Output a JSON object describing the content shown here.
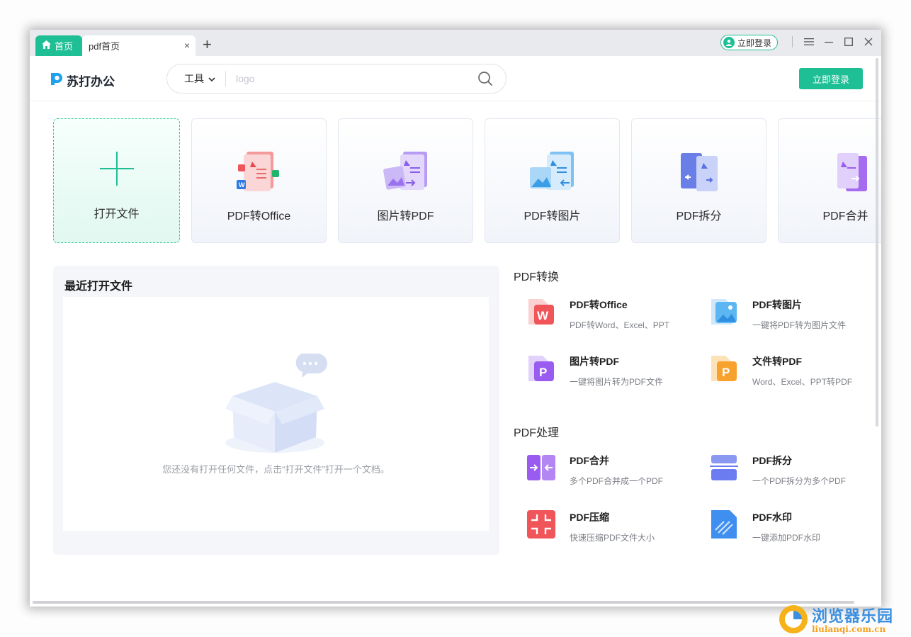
{
  "tabs": {
    "home_label": "首页",
    "active_label": "pdf首页",
    "close_glyph": "×",
    "new_tab_glyph": "+"
  },
  "titlebar": {
    "login_label": "立即登录"
  },
  "header": {
    "logo_text": "苏打办公",
    "tools_label": "工具",
    "search_placeholder": "logo",
    "login_button": "立即登录"
  },
  "cards": [
    {
      "label": "打开文件",
      "icon": "plus-icon"
    },
    {
      "label": "PDF转Office",
      "icon": "pdf-to-office-icon"
    },
    {
      "label": "图片转PDF",
      "icon": "image-to-pdf-icon"
    },
    {
      "label": "PDF转图片",
      "icon": "pdf-to-image-icon"
    },
    {
      "label": "PDF拆分",
      "icon": "pdf-split-icon"
    },
    {
      "label": "PDF合并",
      "icon": "pdf-merge-icon"
    }
  ],
  "recent": {
    "title": "最近打开文件",
    "empty_text": "您还没有打开任何文件，点击“打开文件”打开一个文档。"
  },
  "convert_section": {
    "title": "PDF转换",
    "items": [
      {
        "title": "PDF转Office",
        "desc": "PDF转Word、Excel、PPT",
        "icon": "word-icon",
        "color": "#f0555a"
      },
      {
        "title": "PDF转图片",
        "desc": "一键将PDF转为图片文件",
        "icon": "picture-icon",
        "color": "#3ea8f0"
      },
      {
        "title": "图片转PDF",
        "desc": "一键将图片转为PDF文件",
        "icon": "purple-p-icon",
        "color": "#9a5cf0"
      },
      {
        "title": "文件转PDF",
        "desc": "Word、Excel、PPT转PDF",
        "icon": "orange-p-icon",
        "color": "#f7a22e"
      }
    ]
  },
  "process_section": {
    "title": "PDF处理",
    "items": [
      {
        "title": "PDF合并",
        "desc": "多个PDF合并成一个PDF",
        "icon": "merge-icon",
        "color": "#9a5cf0"
      },
      {
        "title": "PDF拆分",
        "desc": "一个PDF拆分为多个PDF",
        "icon": "split-icon",
        "color": "#6b7cf0"
      },
      {
        "title": "PDF压缩",
        "desc": "快速压缩PDF文件大小",
        "icon": "compress-icon",
        "color": "#f0555a"
      },
      {
        "title": "PDF水印",
        "desc": "一键添加PDF水印",
        "icon": "watermark-icon",
        "color": "#3e8ff0"
      }
    ]
  },
  "watermark": {
    "line1": "浏览器乐园",
    "line2": "liulanqi.com.cn"
  },
  "colors": {
    "accent": "#1fbf95"
  }
}
